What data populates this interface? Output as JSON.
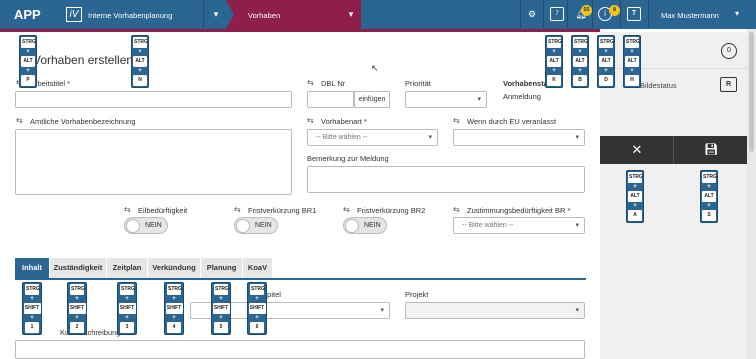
{
  "header": {
    "brand": "APP",
    "module_icon_text": "iV",
    "app_name": "Interne Vorhabenplanung",
    "breadcrumb": "Vorhaben",
    "user": "Max Mustermann",
    "badges": {
      "notifications": "55",
      "info": "8"
    },
    "calendar_day": "7",
    "t_icon": "T"
  },
  "page": {
    "title": "Vorhaben erstellen"
  },
  "form": {
    "arbeitstitel_label": "Arbeitstitel *",
    "dbl_label": "DBL Nr",
    "dbl_button": "einfügen",
    "prioritaet_label": "Priorität",
    "vorhabenstatus_label": "Vorhabenstatus",
    "vorhabenstatus_value": "Anmeldung",
    "amtliche_label": "Amtliche Vorhabenbezeichnung",
    "vorhabenart_label": "Vorhabenart *",
    "vorhabenart_placeholder": "-- Bitte wählen --",
    "eu_label": "Wenn durch EU veranlasst",
    "bemerkung_label": "Bemerkung zur Meldung",
    "eilbeduerftig_label": "Eilbedürftigkeit",
    "frist1_label": "Fristverkürzung BR1",
    "frist2_label": "Fristverkürzung BR2",
    "zustimmung_label": "Zustimmungsbedürftigkeit BR *",
    "zustimmung_placeholder": "-- Bitte wählen --",
    "toggle_value": "NEIN",
    "kapitel_label": "Kapitel",
    "projekt_label": "Projekt",
    "kurz_label": "Kurzbeschreibung"
  },
  "tabs": [
    "Inhalt",
    "Zuständigkeit",
    "Zeitplan",
    "Verkündung",
    "Planung",
    "KoaV"
  ],
  "right_panel": {
    "c_button": "0",
    "bild_label": "Bildestatus",
    "r_button": "R"
  },
  "shortcuts": {
    "strg": "STRG",
    "alt": "ALT",
    "shift": "SHIFT",
    "plus": "+",
    "keys_top": [
      "P",
      "N",
      "K",
      "B",
      "D",
      "H"
    ],
    "keys_panel": [
      "A",
      "S"
    ],
    "keys_tabs": [
      "1",
      "2",
      "3",
      "4",
      "5",
      "6"
    ]
  },
  "colors": {
    "primary": "#2b6591",
    "accent": "#8e1f4b",
    "badge": "#f2c318"
  }
}
